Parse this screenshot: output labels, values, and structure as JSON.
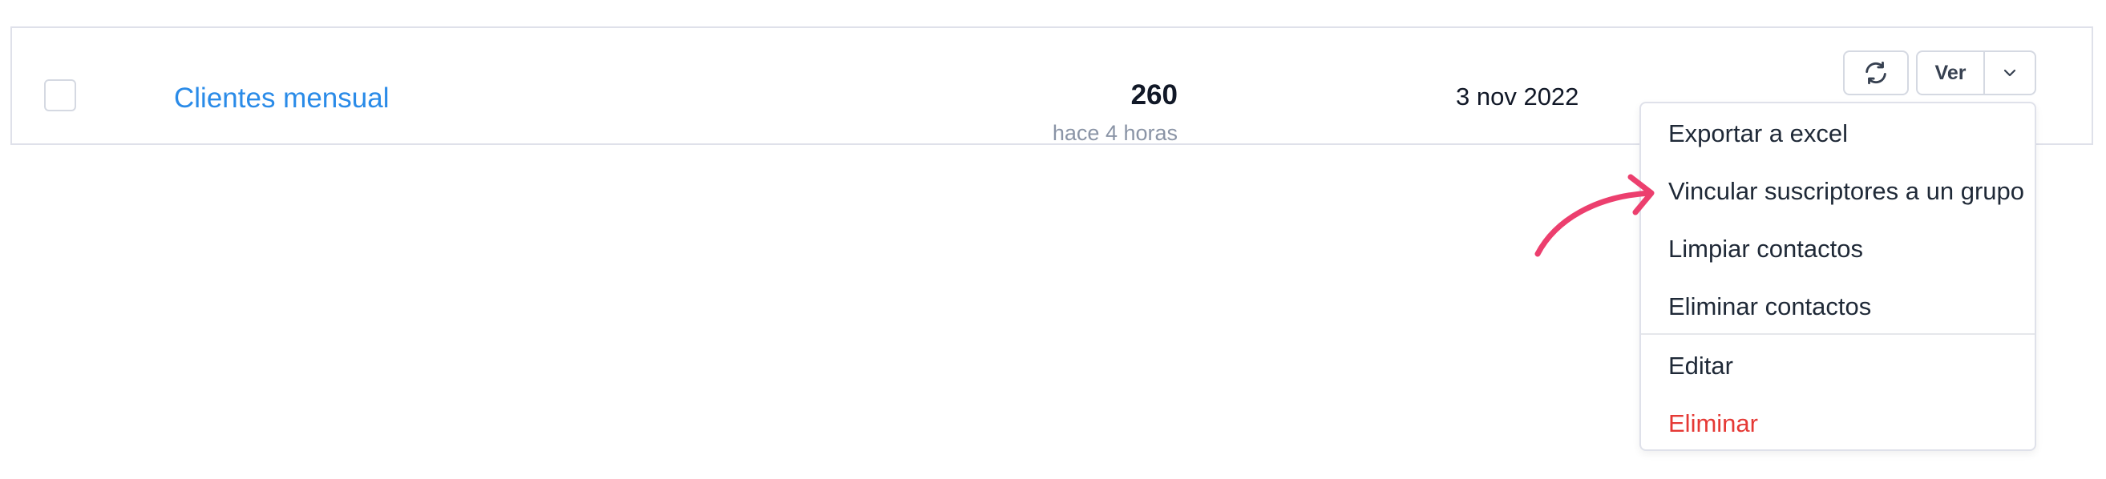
{
  "row": {
    "name": "Clientes mensual",
    "count": "260",
    "updated": "hace 4 horas",
    "date": "3 nov 2022"
  },
  "actions": {
    "view_label": "Ver",
    "refresh_icon": "refresh-icon",
    "caret_icon": "chevron-down-icon"
  },
  "menu": {
    "items": [
      "Exportar a excel",
      "Vincular suscriptores a un grupo",
      "Limpiar contactos",
      "Eliminar contactos",
      "Editar",
      "Eliminar"
    ]
  },
  "colors": {
    "link": "#2a8be8",
    "danger": "#e53935",
    "annotation": "#ec3f6e",
    "border": "#dfe1ea"
  }
}
